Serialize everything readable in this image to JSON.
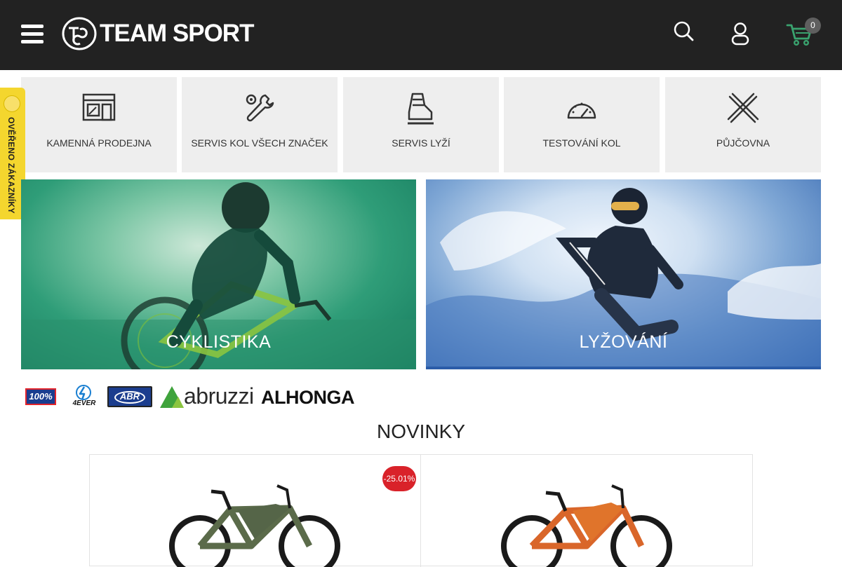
{
  "header": {
    "logo_text": "TEAM SPORT",
    "cart_count": "0"
  },
  "verified_badge": {
    "text": "OVĚŘENO ZÁKAZNÍKY"
  },
  "services": [
    {
      "label": "KAMENNÁ PRODEJNA",
      "icon": "store-icon"
    },
    {
      "label": "SERVIS KOL VŠECH ZNAČEK",
      "icon": "tools-icon"
    },
    {
      "label": "SERVIS LYŽÍ",
      "icon": "ski-boot-icon"
    },
    {
      "label": "TESTOVÁNÍ KOL",
      "icon": "speedometer-icon"
    },
    {
      "label": "PŮJČOVNA",
      "icon": "crossed-skis-icon"
    }
  ],
  "categories": [
    {
      "label": "CYKLISTIKA"
    },
    {
      "label": "LYŽOVÁNÍ"
    }
  ],
  "brands": [
    {
      "name": "100%"
    },
    {
      "name": "4EVER"
    },
    {
      "name": "ABR"
    },
    {
      "name": "abruzzi"
    },
    {
      "name": "ALHONGA"
    }
  ],
  "section": {
    "title": "NOVINKY"
  },
  "products": [
    {
      "discount": "-25.01%"
    },
    {
      "discount": ""
    }
  ],
  "colors": {
    "header_bg": "#222222",
    "tile_bg": "#eeeeee",
    "cart_accent": "#3aa36f",
    "discount_bg": "#d9222a",
    "badge_yellow": "#f4d62e"
  }
}
